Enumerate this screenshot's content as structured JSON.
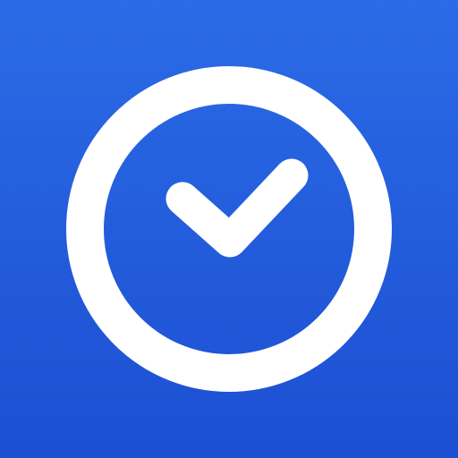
{
  "icon": {
    "name": "clock-check-icon",
    "colors": {
      "background_top": "#2b6be6",
      "background_bottom": "#1c4fd2",
      "glyph": "#ffffff"
    }
  }
}
